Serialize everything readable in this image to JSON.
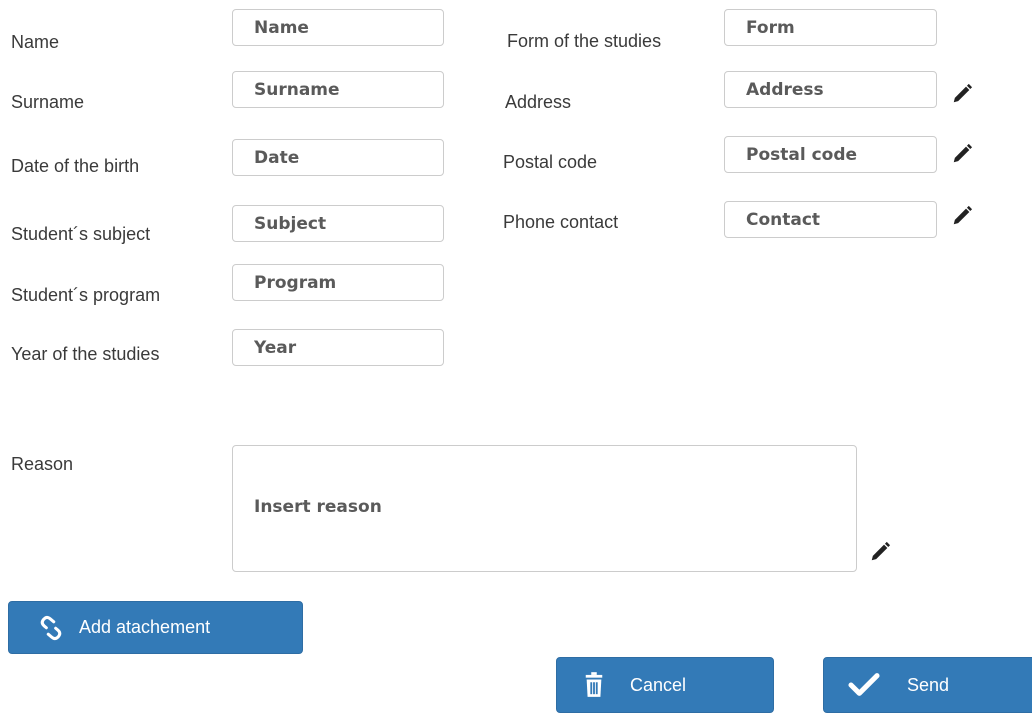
{
  "form": {
    "left": [
      {
        "label": "Name",
        "placeholder": "Name"
      },
      {
        "label": "Surname",
        "placeholder": "Surname"
      },
      {
        "label": "Date of the birth",
        "placeholder": "Date"
      },
      {
        "label": "Student´s subject",
        "placeholder": "Subject"
      },
      {
        "label": "Student´s program",
        "placeholder": "Program"
      },
      {
        "label": "Year of the studies",
        "placeholder": "Year"
      }
    ],
    "right": [
      {
        "label": "Form of the studies",
        "placeholder": "Form"
      },
      {
        "label": "Address",
        "placeholder": "Address"
      },
      {
        "label": "Postal code",
        "placeholder": "Postal code"
      },
      {
        "label": "Phone contact",
        "placeholder": "Contact"
      }
    ],
    "reason": {
      "label": "Reason",
      "placeholder": "Insert reason"
    }
  },
  "buttons": {
    "attach": {
      "label": "Add atachement",
      "icon": "link-icon"
    },
    "cancel": {
      "label": "Cancel",
      "icon": "trash-icon"
    },
    "send": {
      "label": "Send",
      "icon": "check-icon"
    }
  },
  "colors": {
    "button_bg": "#337ab7",
    "input_border": "#cccccc"
  }
}
